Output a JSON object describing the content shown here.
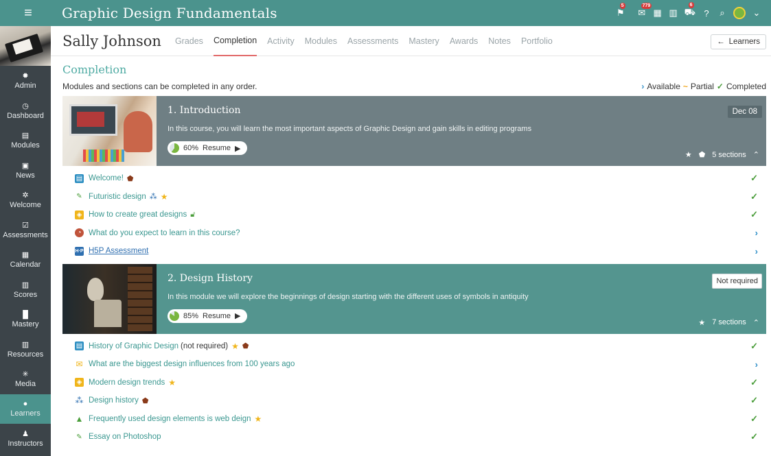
{
  "app": {
    "title": "Graphic Design Fundamentals"
  },
  "topbar": {
    "badges": {
      "alerts": "5",
      "announcements": "779",
      "cart": "6"
    }
  },
  "sidebar": {
    "items": [
      {
        "label": "Admin",
        "icon": "gear-icon"
      },
      {
        "label": "Dashboard",
        "icon": "dashboard-icon"
      },
      {
        "label": "Modules",
        "icon": "modules-icon"
      },
      {
        "label": "News",
        "icon": "news-icon"
      },
      {
        "label": "Welcome",
        "icon": "welcome-icon"
      },
      {
        "label": "Assessments",
        "icon": "assessments-icon"
      },
      {
        "label": "Calendar",
        "icon": "calendar-icon"
      },
      {
        "label": "Scores",
        "icon": "scores-icon"
      },
      {
        "label": "Mastery",
        "icon": "mastery-icon"
      },
      {
        "label": "Resources",
        "icon": "resources-icon"
      },
      {
        "label": "Media",
        "icon": "media-icon"
      },
      {
        "label": "Learners",
        "icon": "learners-icon"
      },
      {
        "label": "Instructors",
        "icon": "instructors-icon"
      }
    ]
  },
  "user": {
    "name": "Sally Johnson"
  },
  "tabs": [
    "Grades",
    "Completion",
    "Activity",
    "Modules",
    "Assessments",
    "Mastery",
    "Awards",
    "Notes",
    "Portfolio"
  ],
  "active_tab": "Completion",
  "learners_button": "Learners",
  "page": {
    "heading": "Completion",
    "info": "Modules and sections can be completed in any order.",
    "legend": {
      "available": "Available",
      "partial": "Partial",
      "completed": "Completed"
    }
  },
  "modules": [
    {
      "title": "1. Introduction",
      "description": "In this course, you will learn the most important aspects of Graphic Design and gain skills in editing programs",
      "progress_percent": 60,
      "progress_label": "60%",
      "resume_label": "Resume",
      "tag": "Dec 08",
      "sections_label": "5 sections",
      "sections": [
        {
          "label": "Welcome!",
          "icon": "page-icon",
          "status": "completed"
        },
        {
          "label": "Futuristic design",
          "icon": "pencil-icon",
          "status": "completed"
        },
        {
          "label": "How to create great designs",
          "icon": "box-icon",
          "status": "completed"
        },
        {
          "label": "What do you expect to learn in this course?",
          "icon": "pie-icon",
          "status": "available"
        },
        {
          "label": "H5P Assessment",
          "icon": "h5p-icon",
          "status": "available"
        }
      ]
    },
    {
      "title": "2. Design History",
      "description": "In this module we will explore the beginnings of design starting with the different uses of symbols in antiquity",
      "progress_percent": 85,
      "progress_label": "85%",
      "resume_label": "Resume",
      "tag": "Not required",
      "sections_label": "7 sections",
      "sections": [
        {
          "label": "History of Graphic Design",
          "extra": "(not required)",
          "icon": "page-icon",
          "status": "completed"
        },
        {
          "label": "What are the biggest design influences from 100 years ago",
          "icon": "chat-icon",
          "status": "available"
        },
        {
          "label": "Modern design trends",
          "icon": "box-icon",
          "status": "completed"
        },
        {
          "label": "Design history",
          "icon": "group-icon",
          "status": "completed"
        },
        {
          "label": "Frequently used design elements is web deign",
          "icon": "thumbs-up-icon",
          "status": "completed"
        },
        {
          "label": "Essay on Photoshop",
          "icon": "pencil-icon",
          "status": "completed"
        }
      ]
    }
  ],
  "colors": {
    "primary": "#4b938d",
    "sidebar": "#3c4449",
    "check": "#4a9d3a",
    "available": "#2f8fc8",
    "partial": "#f0a51a"
  }
}
